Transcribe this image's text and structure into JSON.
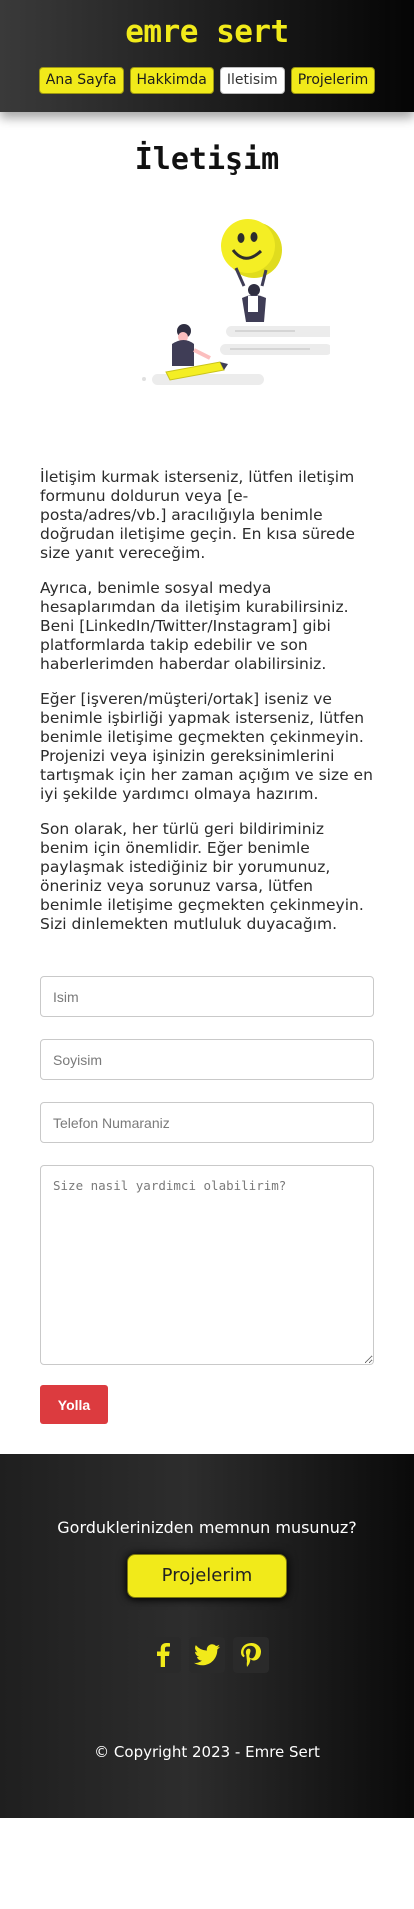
{
  "brand": "emre sert",
  "nav": {
    "items": [
      "Ana Sayfa",
      "Hakkimda",
      "Iletisim",
      "Projelerim"
    ],
    "active": "Iletisim"
  },
  "page_title": "İletişim",
  "paragraphs": [
    "İletişim kurmak isterseniz, lütfen iletişim formunu doldurun veya [e-posta/adres/vb.] aracılığıyla benimle doğrudan iletişime geçin. En kısa sürede size yanıt vereceğim.",
    "Ayrıca, benimle sosyal medya hesaplarımdan da iletişim kurabilirsiniz. Beni [LinkedIn/Twitter/Instagram] gibi platformlarda takip edebilir ve son haberlerimden haberdar olabilirsiniz.",
    "Eğer [işveren/müşteri/ortak] iseniz ve benimle işbirliği yapmak isterseniz, lütfen benimle iletişime geçmekten çekinmeyin. Projenizi veya işinizin gereksinimlerini tartışmak için her zaman açığım ve size en iyi şekilde yardımcı olmaya hazırım.",
    "Son olarak, her türlü geri bildiriminiz benim için önemlidir. Eğer benimle paylaşmak istediğiniz bir yorumunuz, öneriniz veya sorunuz varsa, lütfen benimle iletişime geçmekten çekinmeyin. Sizi dinlemekten mutluluk duyacağım."
  ],
  "form": {
    "first_name_placeholder": "Isim",
    "last_name_placeholder": "Soyisim",
    "phone_placeholder": "Telefon Numaraniz",
    "message_placeholder": "Size nasil yardimci olabilirim?",
    "submit_label": "Yolla"
  },
  "footer": {
    "question": "Gorduklerinizden memnun musunuz?",
    "cta_label": "Projelerim",
    "socials": [
      "facebook-icon",
      "twitter-icon",
      "pinterest-icon"
    ],
    "copyright": "© Copyright 2023 - Emre Sert"
  },
  "colors": {
    "accent_yellow": "#f1ea1a",
    "submit_red": "#dc3b3f",
    "header_dark": "#1f1f1f"
  }
}
